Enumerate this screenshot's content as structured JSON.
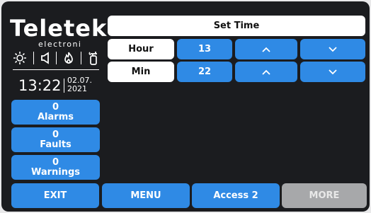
{
  "brand": {
    "name": "Teletek",
    "subtitle": "electroni"
  },
  "clock": {
    "time": "13:22",
    "date_line1": "02.07.",
    "date_line2": "2021"
  },
  "status_icons": [
    "sun-icon",
    "speaker-icon",
    "flame-icon",
    "extinguisher-icon"
  ],
  "stats": [
    {
      "count": "0",
      "label": "Alarms"
    },
    {
      "count": "0",
      "label": "Faults"
    },
    {
      "count": "0",
      "label": "Warnings"
    }
  ],
  "set_time": {
    "title": "Set Time",
    "rows": [
      {
        "label": "Hour",
        "value": "13",
        "up_icon": "chevron-up-icon",
        "down_icon": "chevron-down-icon"
      },
      {
        "label": "Min",
        "value": "22",
        "up_icon": "chevron-up-icon",
        "down_icon": "chevron-down-icon"
      }
    ]
  },
  "footer": {
    "exit": "EXIT",
    "menu": "MENU",
    "access": "Access 2",
    "more": "MORE"
  },
  "colors": {
    "accent": "#2f8ae5",
    "background": "#1b1c1f",
    "disabled": "#a7a8aa"
  }
}
